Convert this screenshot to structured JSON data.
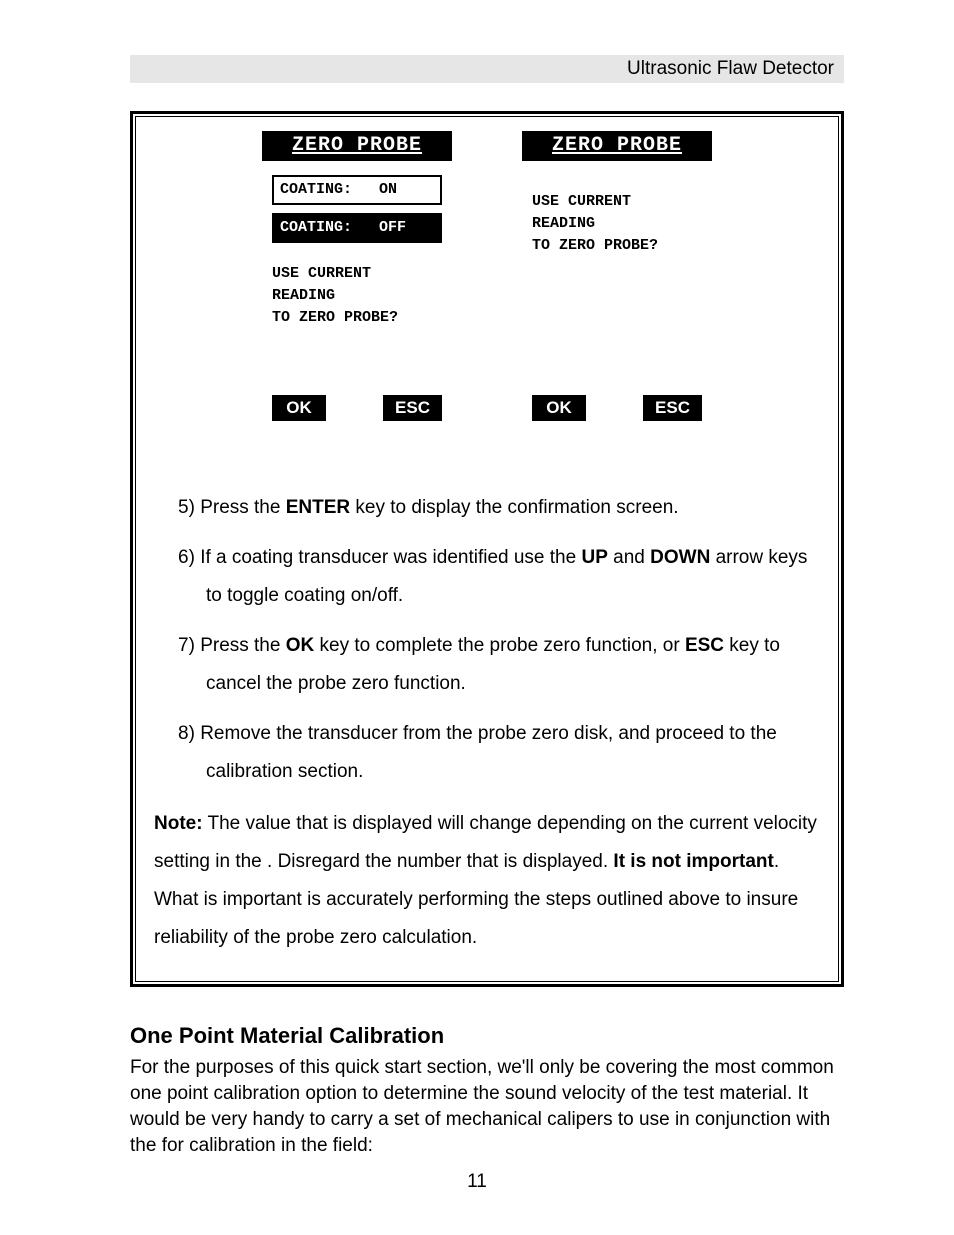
{
  "header": {
    "title": "Ultrasonic Flaw Detector"
  },
  "page_number": "11",
  "lcd_left": {
    "title": "ZERO PROBE",
    "option_on": "COATING:   ON",
    "option_off": "COATING:   OFF",
    "prompt_line1": "USE CURRENT READING",
    "prompt_line2": "TO ZERO PROBE?",
    "btn_ok": "OK",
    "btn_esc": "ESC"
  },
  "lcd_right": {
    "title": "ZERO PROBE",
    "prompt_line1": "USE CURRENT READING",
    "prompt_line2": "TO ZERO PROBE?",
    "btn_ok": "OK",
    "btn_esc": "ESC"
  },
  "steps": {
    "s5": {
      "num": "5)",
      "a": "Press the ",
      "b": "ENTER",
      "c": " key to display the confirmation screen."
    },
    "s6": {
      "num": "6)",
      "a": "If a coating transducer was identified use the ",
      "b": "UP",
      "c": " and ",
      "d": "DOWN",
      "e": " arrow keys to toggle coating on/off."
    },
    "s7": {
      "num": "7)",
      "a": "Press the ",
      "b": "OK",
      "c": " key to complete the probe zero function, or ",
      "d": "ESC",
      "e": " key to cancel the probe zero function."
    },
    "s8": {
      "num": "8)",
      "a": "Remove the transducer from the probe zero disk, and proceed to the calibration section."
    }
  },
  "note": {
    "label": "Note:",
    "a": "  The value that is displayed will change depending on the current velocity setting in the         .  Disregard the number that is displayed.  ",
    "b": "It is not important",
    "c": ".  What is important is accurately performing the steps outlined above to insure reliability of the probe zero calculation."
  },
  "section": {
    "title": "One Point Material Calibration",
    "body": "For the purposes of this quick start section, we'll only be covering the most common one point calibration option to determine the sound velocity of the test material.  It would be very handy to carry a set of mechanical calipers to use in conjunction with the          for calibration in the field:"
  }
}
